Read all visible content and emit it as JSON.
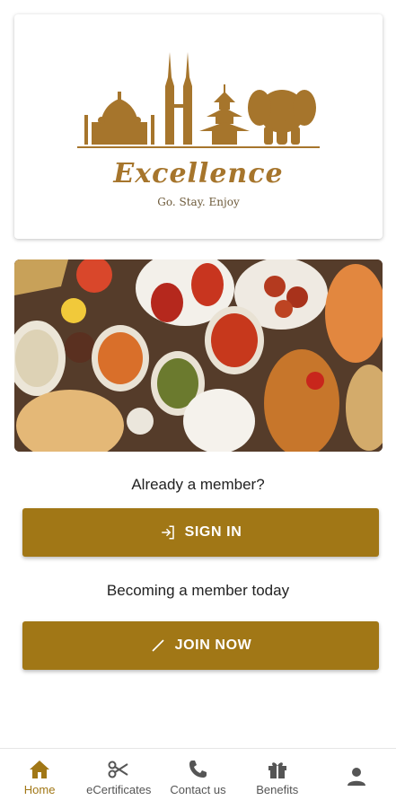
{
  "brand": {
    "name": "Excellence",
    "tagline": "Go. Stay. Enjoy"
  },
  "colors": {
    "accent": "#a17716",
    "logo_gold": "#a6752c",
    "nav_active": "#a17716",
    "nav_inactive": "#555555"
  },
  "login": {
    "member_prompt": "Already a member?",
    "sign_in_label": "SIGN IN",
    "sign_in_icon": "login-icon"
  },
  "join": {
    "prompt": "Becoming a member today",
    "join_label": "JOIN NOW",
    "join_icon": "pencil-icon"
  },
  "bottom_nav": {
    "items": [
      {
        "label": "Home",
        "icon": "home-icon",
        "active": true
      },
      {
        "label": "eCertificates",
        "icon": "scissors-icon",
        "active": false
      },
      {
        "label": "Contact us",
        "icon": "phone-icon",
        "active": false
      },
      {
        "label": "Benefits",
        "icon": "gift-icon",
        "active": false
      },
      {
        "label": "",
        "icon": "profile-icon",
        "active": false
      }
    ]
  }
}
